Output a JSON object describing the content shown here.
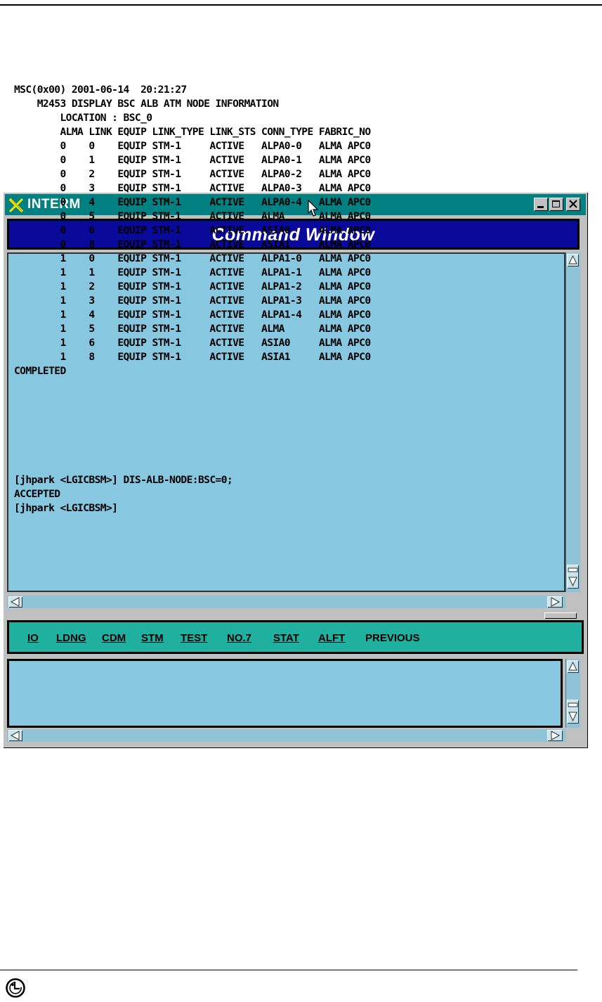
{
  "window": {
    "title": "INTERM",
    "banner": "Command Window"
  },
  "output": {
    "lines": [
      "MSC(0x00) 2001-06-14  20:21:27",
      "    M2453 DISPLAY BSC ALB ATM NODE INFORMATION",
      "        LOCATION : BSC_0",
      "        ALMA LINK EQUIP LINK_TYPE LINK_STS CONN_TYPE FABRIC_NO",
      "        0    0    EQUIP STM-1     ACTIVE   ALPA0-0   ALMA APC0",
      "        0    1    EQUIP STM-1     ACTIVE   ALPA0-1   ALMA APC0",
      "        0    2    EQUIP STM-1     ACTIVE   ALPA0-2   ALMA APC0",
      "        0    3    EQUIP STM-1     ACTIVE   ALPA0-3   ALMA APC0",
      "        0    4    EQUIP STM-1     ACTIVE   ALPA0-4   ALMA APC0",
      "        0    5    EQUIP STM-1     ACTIVE   ALMA      ALMA APC0",
      "        0    6    EQUIP STM-1     ACTIVE   ASIA0     ALMA APC0",
      "        0    8    EQUIP STM-1     ACTIVE   ASIA1     ALMA APC0",
      "        1    0    EQUIP STM-1     ACTIVE   ALPA1-0   ALMA APC0",
      "        1    1    EQUIP STM-1     ACTIVE   ALPA1-1   ALMA APC0",
      "        1    2    EQUIP STM-1     ACTIVE   ALPA1-2   ALMA APC0",
      "        1    3    EQUIP STM-1     ACTIVE   ALPA1-3   ALMA APC0",
      "        1    4    EQUIP STM-1     ACTIVE   ALPA1-4   ALMA APC0",
      "        1    5    EQUIP STM-1     ACTIVE   ALMA      ALMA APC0",
      "        1    6    EQUIP STM-1     ACTIVE   ASIA0     ALMA APC0",
      "        1    8    EQUIP STM-1     ACTIVE   ASIA1     ALMA APC0",
      "COMPLETED"
    ]
  },
  "menu": {
    "items": [
      "IO",
      "LDNG",
      "CDM",
      "STM",
      "TEST",
      "NO.7",
      "STAT",
      "ALFT",
      "PREVIOUS"
    ]
  },
  "input": {
    "lines": [
      "[jhpark <LGICBSM>] DIS-ALB-NODE:BSC=0;",
      "ACCEPTED",
      "[jhpark <LGICBSM>]"
    ]
  },
  "colors": {
    "titlebar": "#008080",
    "banner": "#0a0a9a",
    "panel": "#87c8e0",
    "menubar": "#20b0a0"
  },
  "icons": [
    "x-logo-icon",
    "cursor-arrow-icon",
    "minimize-icon",
    "maximize-icon",
    "close-icon",
    "scroll-up-icon",
    "scroll-down-icon",
    "scroll-left-icon",
    "scroll-right-icon",
    "lg-logo-icon"
  ]
}
